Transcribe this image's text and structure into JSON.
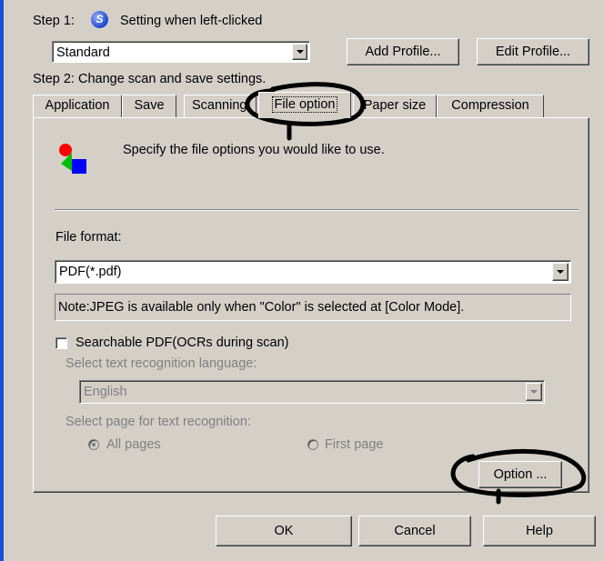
{
  "step1": {
    "label": "Step 1:",
    "icon": "scansnap-manager-icon",
    "trigger": "Setting when left-clicked",
    "profile_value": "Standard",
    "add_profile_label": "Add Profile...",
    "edit_profile_label": "Edit Profile..."
  },
  "step2": {
    "label": "Step 2: Change scan and save settings."
  },
  "tabs": [
    {
      "label": "Application"
    },
    {
      "label": "Save"
    },
    {
      "label": "Scanning"
    },
    {
      "label": "File option",
      "active": true
    },
    {
      "label": "Paper size"
    },
    {
      "label": "Compression"
    }
  ],
  "panel": {
    "icon": "file-options-icon",
    "description": "Specify the file options you would like to use.",
    "file_format_label": "File format:",
    "file_format_value": "PDF(*.pdf)",
    "note": "Note:JPEG is available only when \"Color\" is selected at [Color Mode].",
    "searchable_pdf_label": "Searchable PDF(OCRs during scan)",
    "searchable_pdf_checked": false,
    "language_label": "Select text recognition language:",
    "language_value": "English",
    "page_select_label": "Select page for text recognition:",
    "all_pages_label": "All pages",
    "first_page_label": "First page",
    "option_button_label": "Option ..."
  },
  "footer": {
    "ok_label": "OK",
    "cancel_label": "Cancel",
    "help_label": "Help"
  },
  "colors": {
    "dialog_bg": "#d4d0c8",
    "accent_stripe": "#1c4fd0",
    "annotation_ink": "#000000"
  }
}
